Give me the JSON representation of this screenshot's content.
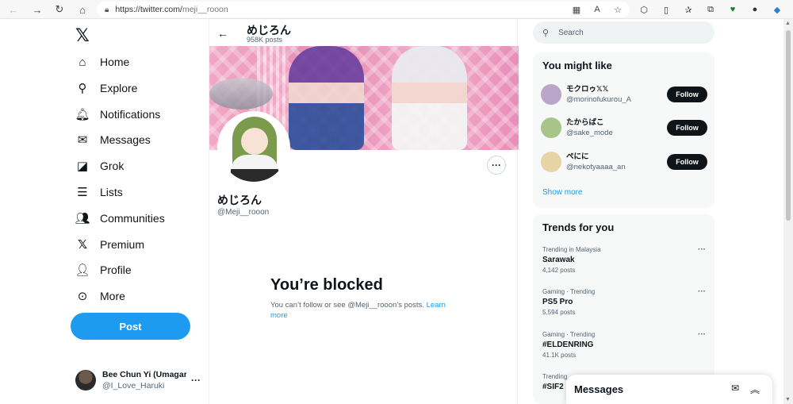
{
  "browser": {
    "url_host": "https://twitter.com/",
    "url_path": "meji__rooon"
  },
  "sidebar": {
    "items": [
      {
        "label": "Home",
        "icon": "home-icon"
      },
      {
        "label": "Explore",
        "icon": "search-icon"
      },
      {
        "label": "Notifications",
        "icon": "bell-icon"
      },
      {
        "label": "Messages",
        "icon": "envelope-icon"
      },
      {
        "label": "Grok",
        "icon": "grok-icon"
      },
      {
        "label": "Lists",
        "icon": "list-icon"
      },
      {
        "label": "Communities",
        "icon": "people-icon"
      },
      {
        "label": "Premium",
        "icon": "x-icon"
      },
      {
        "label": "Profile",
        "icon": "person-icon"
      },
      {
        "label": "More",
        "icon": "more-circle-icon"
      }
    ],
    "post_label": "Post",
    "account": {
      "name": "Bee Chun Yi (Umagar",
      "handle": "@I_Love_Haruki"
    }
  },
  "profile": {
    "header_name": "めじろん",
    "header_posts": "958K posts",
    "name": "めじろん",
    "handle": "@Meji__rooon",
    "blocked_title": "You’re blocked",
    "blocked_desc": "You can’t follow or see @Meji__rooon’s posts. ",
    "learn_more": "Learn more"
  },
  "right": {
    "search_placeholder": "Search",
    "might_like_title": "You might like",
    "suggestions": [
      {
        "name": "モクロゥ𝕏𝕏",
        "handle": "@morinofukurou_A",
        "follow": "Follow",
        "avatar_color": "#b9a6c9"
      },
      {
        "name": "たからばこ",
        "handle": "@sake_mode",
        "follow": "Follow",
        "avatar_color": "#a9c48a"
      },
      {
        "name": "ぺにに",
        "handle": "@nekotyaaaa_an",
        "follow": "Follow",
        "avatar_color": "#e8d3a6"
      }
    ],
    "show_more": "Show more",
    "trends_title": "Trends for you",
    "trends": [
      {
        "meta": "Trending in Malaysia",
        "name": "Sarawak",
        "count": "4,142 posts"
      },
      {
        "meta": "Gaming · Trending",
        "name": "PS5 Pro",
        "count": "5,594 posts"
      },
      {
        "meta": "Gaming · Trending",
        "name": "#ELDENRING",
        "count": "41.1K posts"
      },
      {
        "meta": "Trending",
        "name": "#SIF2",
        "count": ""
      }
    ]
  },
  "messages_drawer": {
    "title": "Messages"
  }
}
